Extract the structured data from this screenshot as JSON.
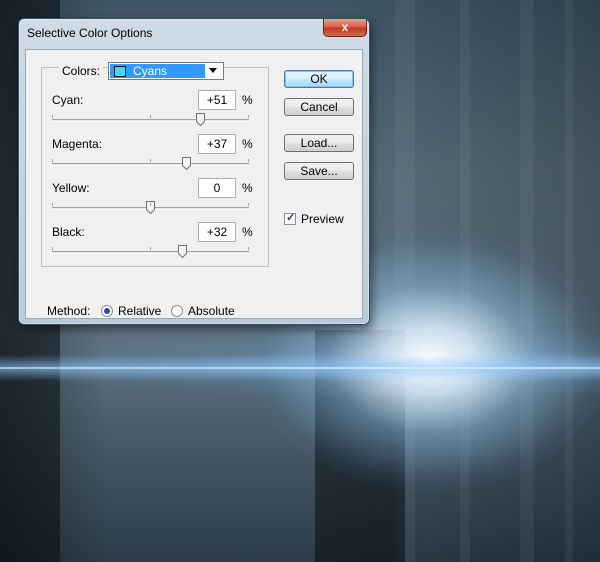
{
  "window": {
    "title": "Selective Color Options",
    "close_label": "x"
  },
  "colors": {
    "label": "Colors:",
    "selected": "Cyans",
    "swatch_color": "#3fd9ff"
  },
  "sliders": [
    {
      "label": "Cyan:",
      "value": "+51",
      "unit": "%",
      "percent": 51
    },
    {
      "label": "Magenta:",
      "value": "+37",
      "unit": "%",
      "percent": 37
    },
    {
      "label": "Yellow:",
      "value": "0",
      "unit": "%",
      "percent": 0
    },
    {
      "label": "Black:",
      "value": "+32",
      "unit": "%",
      "percent": 32
    }
  ],
  "buttons": {
    "ok": "OK",
    "cancel": "Cancel",
    "load": "Load...",
    "save": "Save..."
  },
  "preview": {
    "label": "Preview",
    "checked": true
  },
  "method": {
    "label": "Method:",
    "relative": "Relative",
    "absolute": "Absolute",
    "selected": "relative"
  },
  "accent": "#3399ff"
}
